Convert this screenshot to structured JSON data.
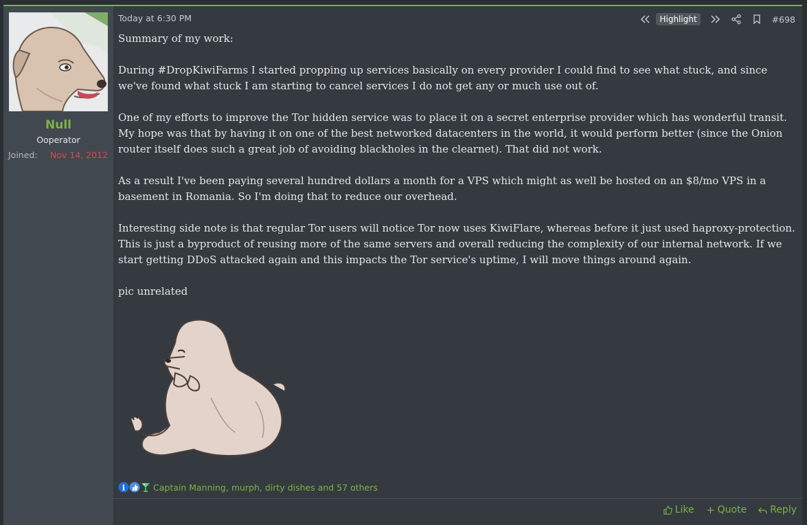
{
  "user": {
    "name": "Null",
    "title": "Ooperator",
    "joined_label": "Joined:",
    "joined_value": "Nov 14, 2012"
  },
  "post": {
    "date": "Today at 6:30 PM",
    "highlight_label": "Highlight",
    "number": "#698",
    "paragraphs": [
      "Summary of my work:",
      "During #DropKiwiFarms I started propping up services basically on every provider I could find to see what stuck, and since we've found what stuck I am starting to cancel services I do not get any or much use out of.",
      "One of my efforts to improve the Tor hidden service was to place it on a secret enterprise provider which has wonderful transit. My hope was that by having it on one of the best networked datacenters in the world, it would perform better (since the Onion router itself does such a great job of avoiding blackholes in the clearnet). That did not work.",
      "As a result I've been paying several hundred dollars a month for a VPS which might as well be hosted on an $8/mo VPS in a basement in Romania. So I'm doing that to reduce our overhead.",
      "Interesting side note is that regular Tor users will notice Tor now uses KiwiFlare, whereas before it just used haproxy-protection. This is just a byproduct of reusing more of the same servers and overall reducing the complexity of our internal network. If we start getting DDoS attacked again and this impacts the Tor service's uptime, I will move things around again.",
      "pic unrelated"
    ]
  },
  "reactions": {
    "icons": [
      "informative-icon",
      "like-icon",
      "cocktail-icon"
    ],
    "text": "Captain Manning, murph, dirty dishes and 57 others"
  },
  "actions": {
    "like": "Like",
    "quote": "Quote",
    "reply": "Reply"
  },
  "colors": {
    "accent": "#7cb342",
    "joined_date": "#d14b4b",
    "background": "#353a40",
    "user_column": "#424850"
  }
}
